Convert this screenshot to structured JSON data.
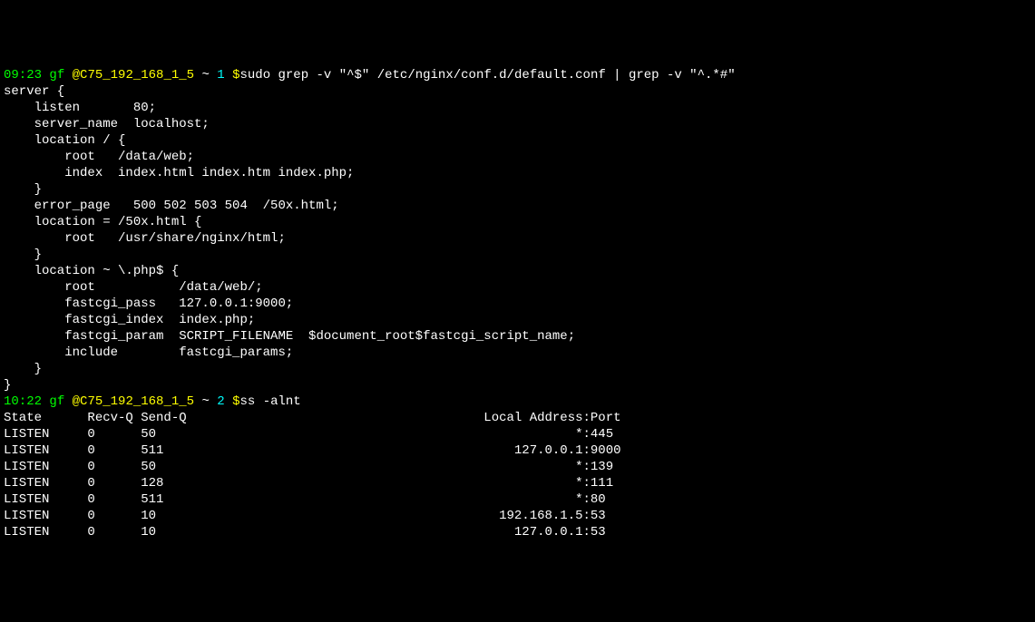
{
  "prompt1": {
    "time": "09:23",
    "user": "gf",
    "host": "@C75_192_168_1_5",
    "tilde": "~",
    "num": "1",
    "dollar": "$",
    "cmd": "sudo grep -v \"^$\" /etc/nginx/conf.d/default.conf | grep -v \"^.*#\""
  },
  "config_lines": [
    "server {",
    "    listen       80;",
    "    server_name  localhost;",
    "    location / {",
    "        root   /data/web;",
    "        index  index.html index.htm index.php;",
    "    }",
    "    error_page   500 502 503 504  /50x.html;",
    "    location = /50x.html {",
    "        root   /usr/share/nginx/html;",
    "    }",
    "    location ~ \\.php$ {",
    "        root           /data/web/;",
    "        fastcgi_pass   127.0.0.1:9000;",
    "        fastcgi_index  index.php;",
    "        fastcgi_param  SCRIPT_FILENAME  $document_root$fastcgi_script_name;",
    "        include        fastcgi_params;",
    "    }",
    "}"
  ],
  "prompt2": {
    "time": "10:22",
    "user": "gf",
    "host": "@C75_192_168_1_5",
    "tilde": "~",
    "num": "2",
    "dollar": "$",
    "cmd": "ss -alnt"
  },
  "ss_header": "State      Recv-Q Send-Q                                       Local Address:Port",
  "ss_rows": [
    "LISTEN     0      50                                                       *:445",
    "LISTEN     0      511                                              127.0.0.1:9000",
    "LISTEN     0      50                                                       *:139",
    "LISTEN     0      128                                                      *:111",
    "LISTEN     0      511                                                      *:80",
    "LISTEN     0      10                                             192.168.1.5:53",
    "LISTEN     0      10                                               127.0.0.1:53"
  ]
}
